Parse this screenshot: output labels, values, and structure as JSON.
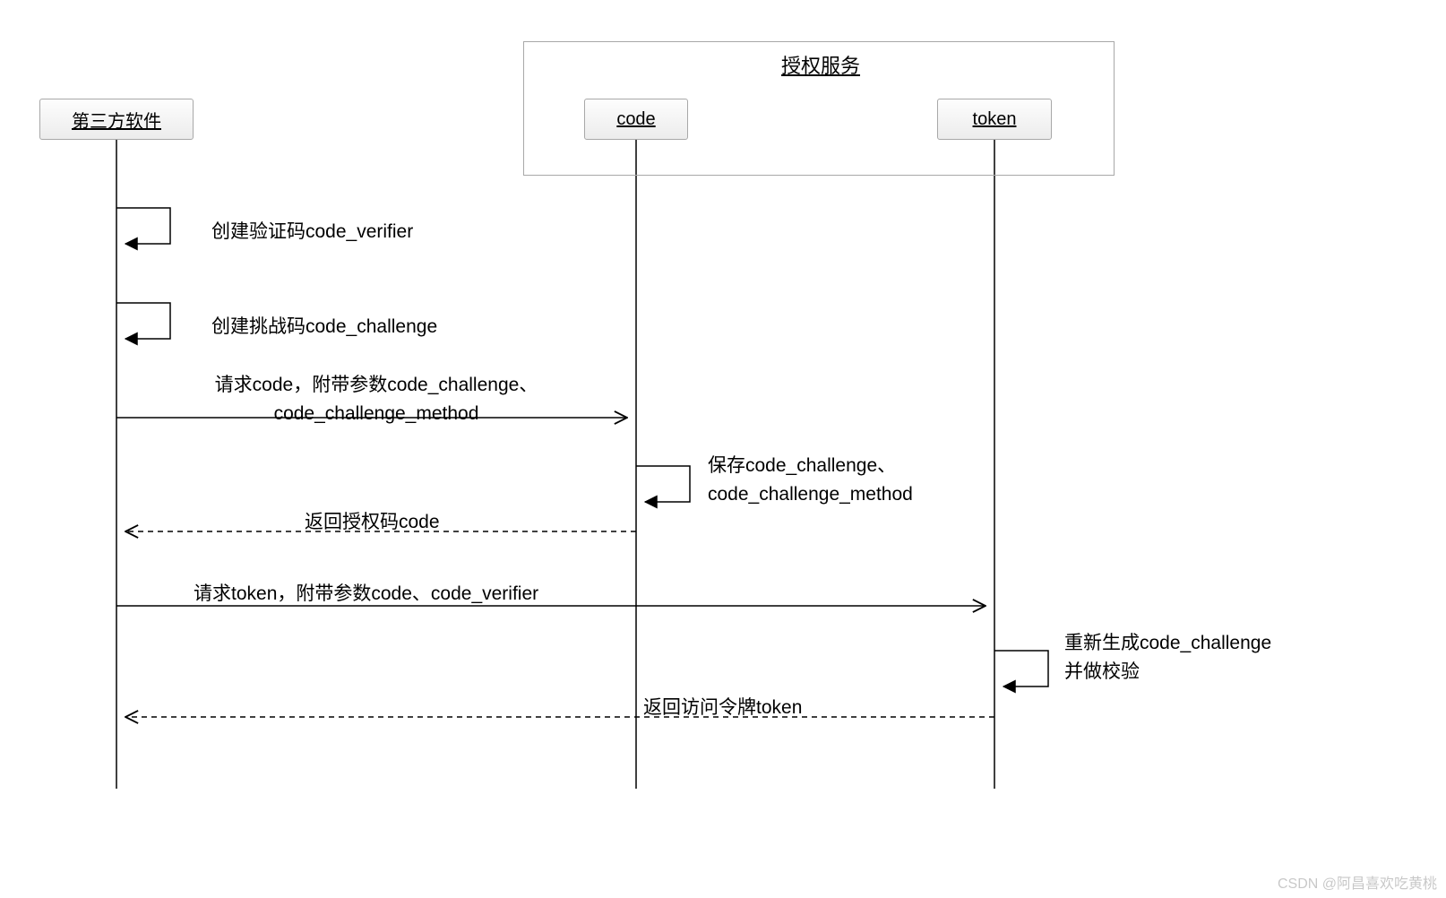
{
  "diagram": {
    "type": "sequence",
    "group_title": "授权服务",
    "participants": {
      "client": "第三方软件",
      "code": "code",
      "token": "token"
    },
    "messages": {
      "m1": "创建验证码code_verifier",
      "m2": "创建挑战码code_challenge",
      "m3_line1": "请求code，附带参数code_challenge、",
      "m3_line2": "code_challenge_method",
      "m4_line1": "保存code_challenge、",
      "m4_line2": "code_challenge_method",
      "m5": "返回授权码code",
      "m6": "请求token，附带参数code、code_verifier",
      "m7_line1": "重新生成code_challenge",
      "m7_line2": "并做校验",
      "m8": "返回访问令牌token"
    }
  },
  "watermark": "CSDN @阿昌喜欢吃黄桃"
}
